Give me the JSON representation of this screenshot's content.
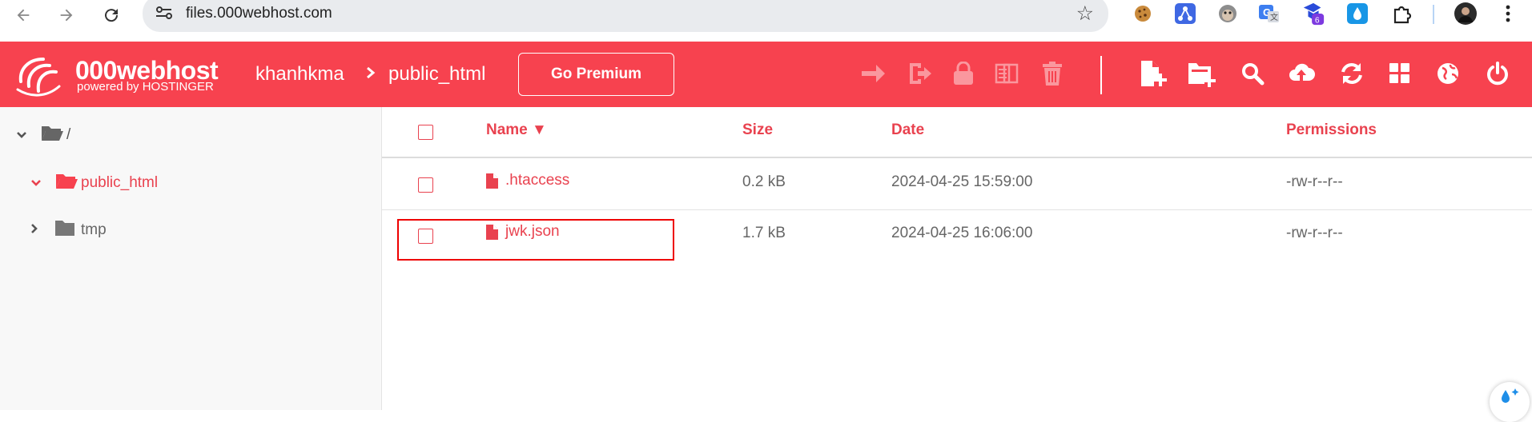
{
  "browser": {
    "url": "files.000webhost.com",
    "icons": [
      "back-icon",
      "forward-icon",
      "reload-icon",
      "tune-icon",
      "bookmark-star-icon",
      "cookie-extension-icon",
      "network-extension-icon",
      "monkey-extension-icon",
      "translate-extension-icon",
      "extension-badge-icon",
      "drop-extension-icon",
      "puzzle-extensions-icon",
      "profile-avatar",
      "more-vert-icon"
    ],
    "extension_badge": "6"
  },
  "app": {
    "brand_color": "#f7424f",
    "logo_main": "000webhost",
    "logo_sub": "powered by HOSTINGER",
    "breadcrumb": [
      "khanhkma",
      "public_html"
    ],
    "premium_label": "Go Premium",
    "toolbar_icons": [
      "move-icon",
      "rename-icon",
      "permissions-icon",
      "archive-icon",
      "delete-icon",
      "new-file-icon",
      "new-folder-icon",
      "search-icon",
      "upload-icon",
      "refresh-icon",
      "grid-view-icon",
      "web-icon",
      "power-icon"
    ]
  },
  "sidebar": {
    "items": [
      {
        "label": "/",
        "expanded": true
      },
      {
        "label": "public_html",
        "expanded": true,
        "active": true
      },
      {
        "label": "tmp",
        "expanded": false
      }
    ]
  },
  "table": {
    "headers": {
      "name": "Name ▼",
      "size": "Size",
      "date": "Date",
      "permissions": "Permissions"
    },
    "rows": [
      {
        "name": ".htaccess",
        "size": "0.2 kB",
        "date": "2024-04-25 15:59:00",
        "permissions": "-rw-r--r--"
      },
      {
        "name": "jwk.json",
        "size": "1.7 kB",
        "date": "2024-04-25 16:06:00",
        "permissions": "-rw-r--r--"
      }
    ]
  }
}
